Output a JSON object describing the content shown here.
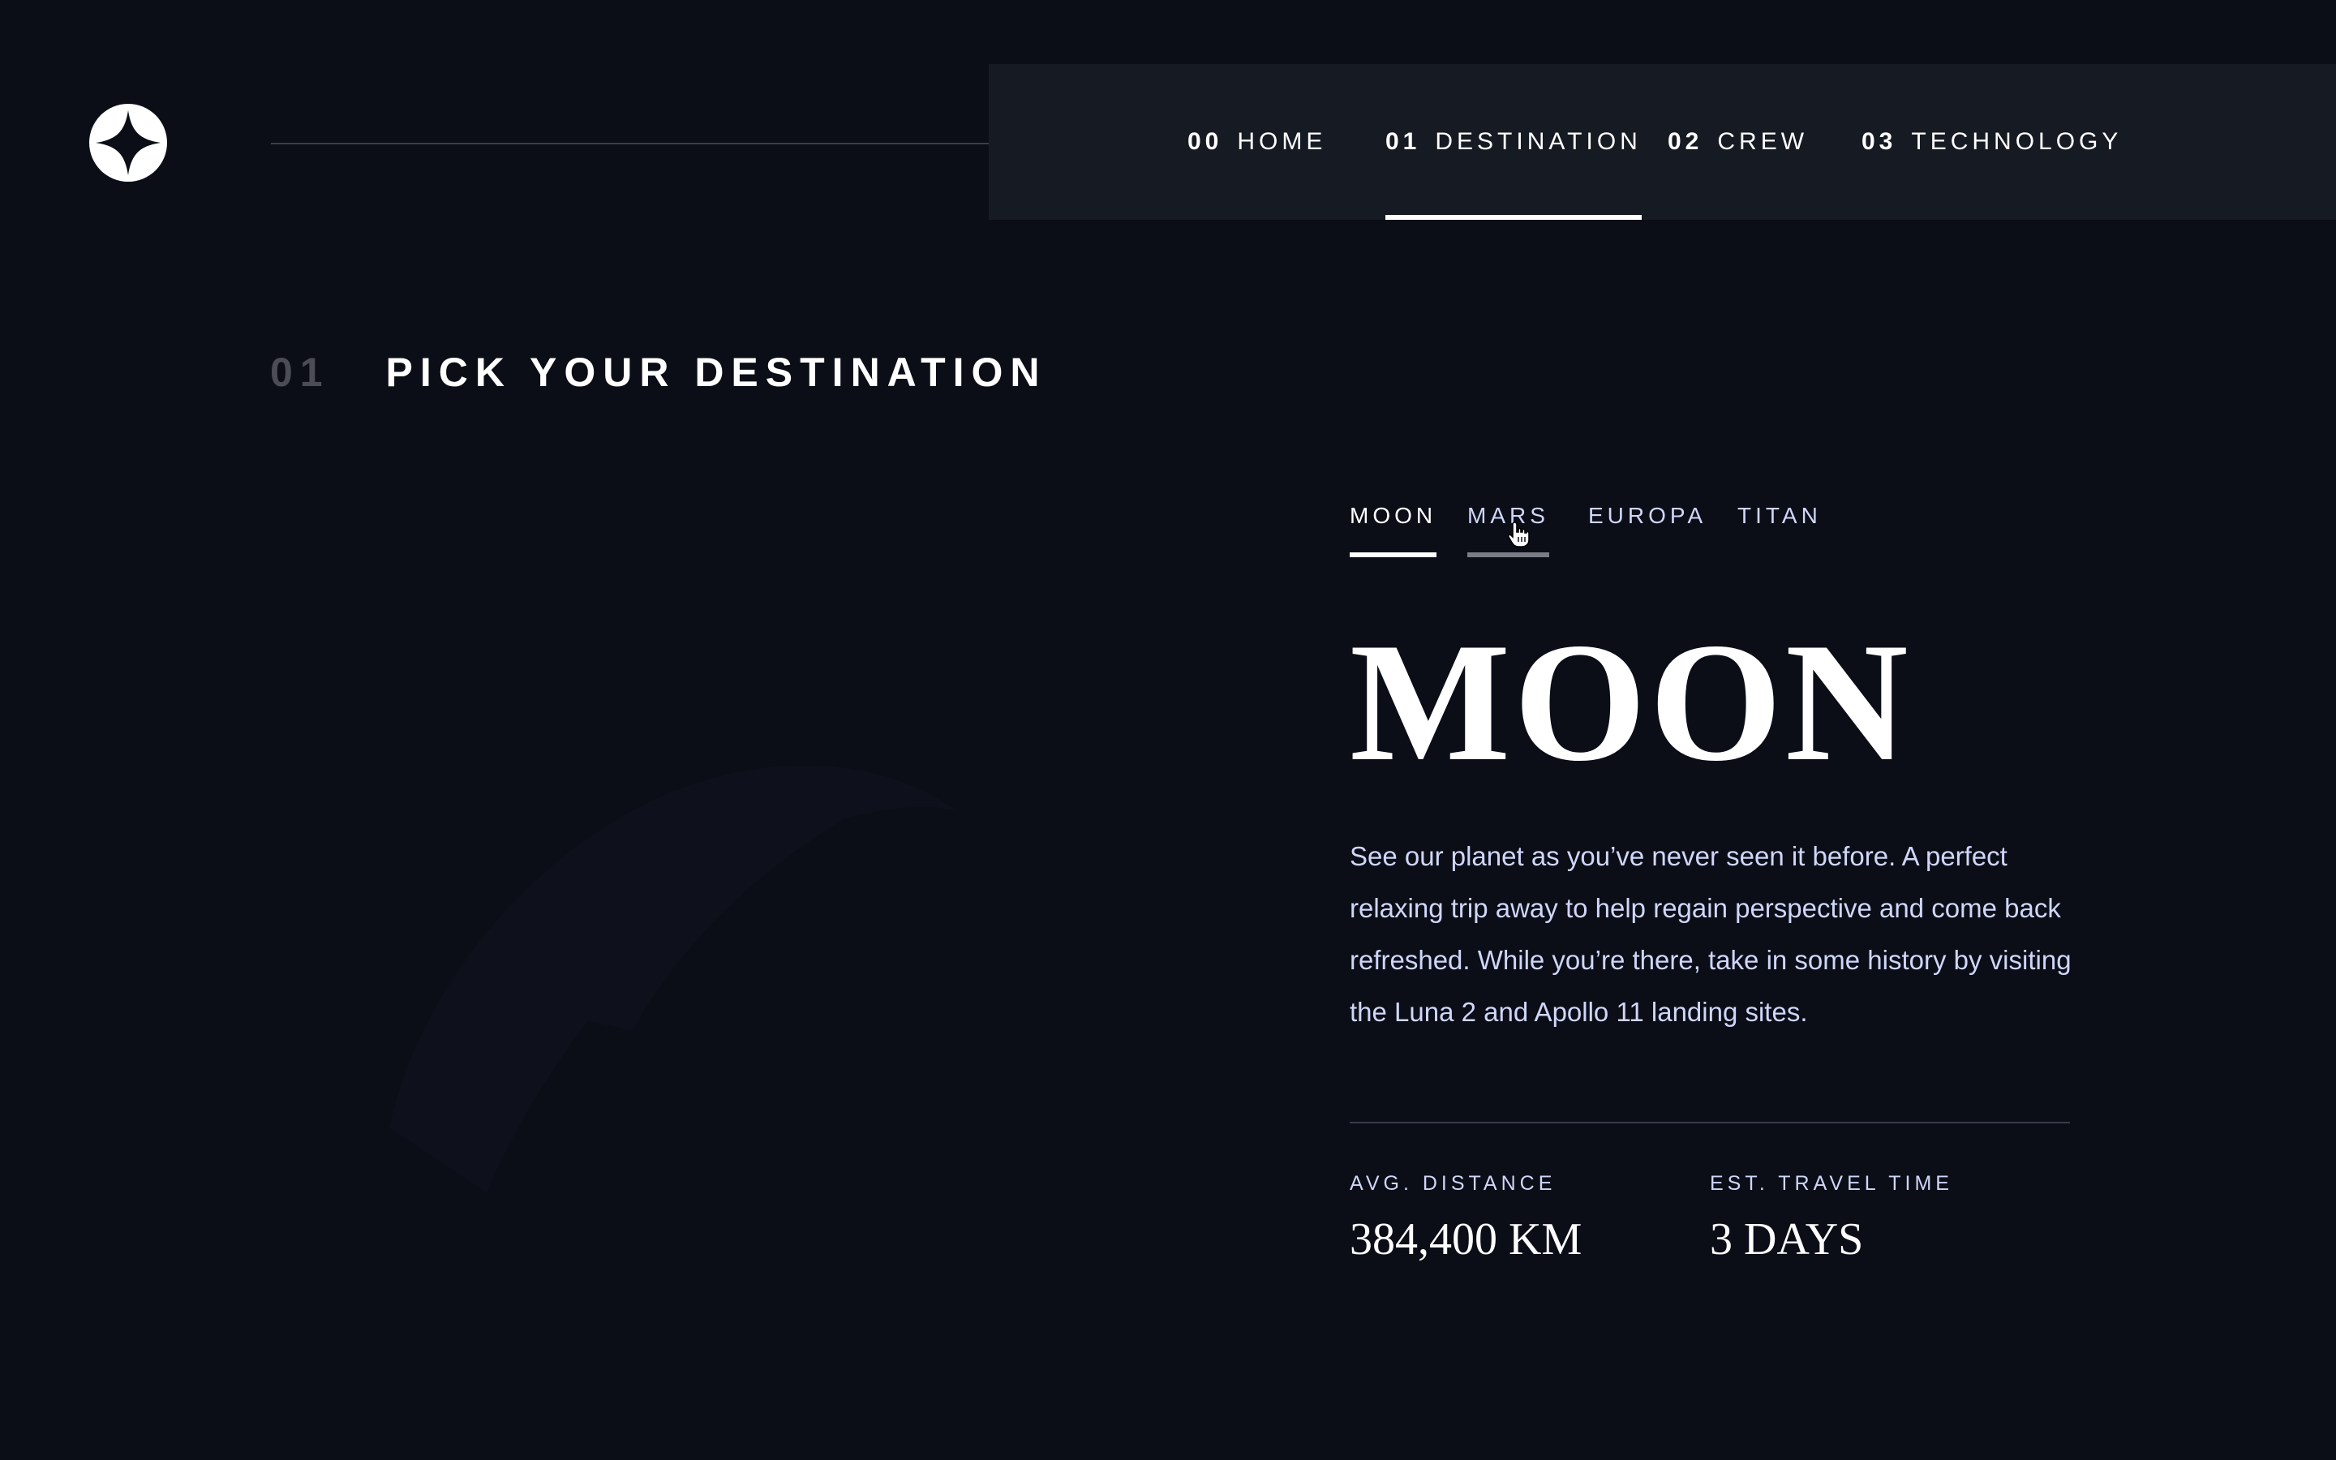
{
  "header": {
    "logo_icon": "star-logo-icon",
    "nav": [
      {
        "num": "00",
        "label": "HOME",
        "active": false
      },
      {
        "num": "01",
        "label": "DESTINATION",
        "active": true
      },
      {
        "num": "02",
        "label": "CREW",
        "active": false
      },
      {
        "num": "03",
        "label": "TECHNOLOGY",
        "active": false
      }
    ]
  },
  "page": {
    "heading_num": "01",
    "heading_label": "PICK YOUR DESTINATION"
  },
  "tabs": [
    {
      "label": "MOON",
      "state": "active"
    },
    {
      "label": "MARS",
      "state": "hover"
    },
    {
      "label": "EUROPA",
      "state": "default"
    },
    {
      "label": "TITAN",
      "state": "default"
    }
  ],
  "destination": {
    "name": "MOON",
    "description": "See our planet as you’ve never seen it before. A perfect relaxing trip away to help regain perspective and come back refreshed. While you’re there, take in some history by visiting the Luna 2 and Apollo 11 landing sites.",
    "distance_label": "AVG. DISTANCE",
    "distance_value": "384,400 KM",
    "travel_label": "EST. TRAVEL TIME",
    "travel_value": "3 DAYS"
  },
  "colors": {
    "background": "#0b0e17",
    "nav_panel": "#161a23",
    "accent_text": "#d0d6f9",
    "white": "#ffffff"
  }
}
